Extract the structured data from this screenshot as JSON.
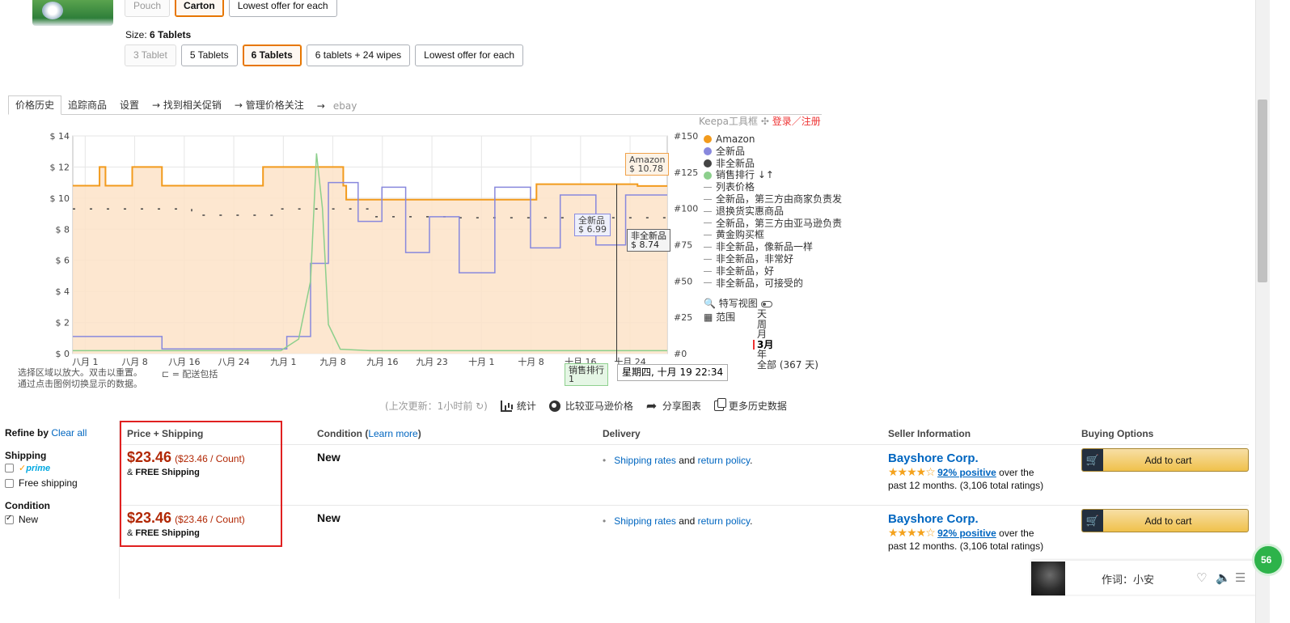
{
  "product": {
    "style_options": [
      {
        "label": "Pouch",
        "state": "disabled"
      },
      {
        "label": "Carton",
        "state": "selected"
      },
      {
        "label": "Lowest offer for each",
        "state": "normal"
      }
    ],
    "size_label": "Size:",
    "size_value": "6 Tablets",
    "size_options": [
      {
        "label": "3 Tablet",
        "state": "disabled"
      },
      {
        "label": "5 Tablets",
        "state": "normal"
      },
      {
        "label": "6 Tablets",
        "state": "selected"
      },
      {
        "label": "6 tablets + 24 wipes",
        "state": "normal"
      },
      {
        "label": "Lowest offer for each",
        "state": "normal"
      }
    ]
  },
  "keepa": {
    "tabs": [
      "价格历史",
      "追踪商品",
      "设置",
      "→ 找到相关促销",
      "→ 管理价格关注",
      "→",
      "ebay"
    ],
    "toolbox": "Keepa工具框",
    "login": "登录／注册",
    "legend": [
      {
        "label": "Amazon",
        "color": "#f29b1d",
        "kind": "dot"
      },
      {
        "label": "全新品",
        "color": "#8888dd",
        "kind": "dot"
      },
      {
        "label": "非全新品",
        "color": "#444444",
        "kind": "dot"
      },
      {
        "label": "销售排行",
        "color": "#8ccf8c",
        "kind": "dot",
        "suffix": "↓↑"
      },
      {
        "label": "列表价格",
        "kind": "dash"
      },
      {
        "label": "全新品，第三方由商家负责发",
        "kind": "dash"
      },
      {
        "label": "退换货实惠商品",
        "kind": "dash"
      },
      {
        "label": "全新品，第三方由亚马逊负责",
        "kind": "dash"
      },
      {
        "label": "黄金购买框",
        "kind": "dash"
      },
      {
        "label": "非全新品，像新品一样",
        "kind": "dash"
      },
      {
        "label": "非全新品，非常好",
        "kind": "dash"
      },
      {
        "label": "非全新品，好",
        "kind": "dash"
      },
      {
        "label": "非全新品，可接受的",
        "kind": "dash"
      }
    ],
    "closeup_label": "特写视图",
    "range_label": "范围",
    "range_options": [
      "天",
      "周",
      "月",
      "3月",
      "年",
      "全部 (367 天)"
    ],
    "range_selected": "3月",
    "tooltips": {
      "amazon_name": "Amazon",
      "amazon_price": "$ 10.78",
      "new_name": "全新品",
      "new_price": "$ 6.99",
      "used_name": "非全新品",
      "used_price": "$ 8.74",
      "rank_name": "销售排行",
      "rank_value": "1",
      "date": "星期四, 十月 19 22:34"
    },
    "note_line1": "选择区域以放大。双击以重置。",
    "note_line2": "通过点击图例切换显示的数据。",
    "note_shipping": "⊏ = 配送包括",
    "toolbar": {
      "updated": "(上次更新：1小时前 ↻)",
      "stats": "统计",
      "compare": "比较亚马逊价格",
      "share": "分享图表",
      "more": "更多历史数据"
    }
  },
  "chart_data": {
    "type": "line",
    "title": "",
    "x_categories": [
      "八月 1",
      "八月 8",
      "八月 16",
      "八月 24",
      "九月 1",
      "九月 8",
      "九月 16",
      "九月 23",
      "十月 1",
      "十月 8",
      "十月 16",
      "十月 24"
    ],
    "y_left_ticks": [
      "$ 0",
      "$ 2",
      "$ 4",
      "$ 6",
      "$ 8",
      "$ 10",
      "$ 12",
      "$ 14"
    ],
    "y_left_range": [
      0,
      14
    ],
    "y_right_ticks": [
      "#0",
      "#25",
      "#50",
      "#75",
      "#100",
      "#125",
      "#150"
    ],
    "y_right_range": [
      0,
      150
    ],
    "grid": true,
    "legend_position": "right",
    "series": [
      {
        "name": "Amazon",
        "color": "#f29b1d",
        "fill": "#fde3c8",
        "x": [
          0,
          0.045,
          0.045,
          0.055,
          0.055,
          0.1,
          0.1,
          0.15,
          0.15,
          0.32,
          0.32,
          0.455,
          0.455,
          0.46,
          0.46,
          0.78,
          0.78,
          0.95,
          0.95,
          1.0
        ],
        "values": [
          10.8,
          10.8,
          12,
          12,
          10.8,
          10.8,
          12,
          12,
          10.8,
          10.8,
          12,
          12,
          10.8,
          10.8,
          9.9,
          9.9,
          10.9,
          10.9,
          10.78,
          10.78
        ]
      },
      {
        "name": "全新品",
        "color": "#8888dd",
        "x": [
          0,
          0.15,
          0.15,
          0.36,
          0.36,
          0.4,
          0.4,
          0.43,
          0.43,
          0.48,
          0.48,
          0.52,
          0.52,
          0.56,
          0.56,
          0.6,
          0.6,
          0.65,
          0.65,
          0.71,
          0.71,
          0.77,
          0.77,
          0.82,
          0.82,
          0.88,
          0.88,
          0.93,
          0.93,
          1.0
        ],
        "values": [
          1.1,
          1.1,
          0.3,
          0.3,
          1.1,
          1.1,
          5.8,
          5.8,
          11,
          11,
          8.5,
          8.5,
          10.7,
          10.7,
          6.5,
          6.5,
          8.8,
          8.8,
          5.2,
          5.2,
          10.7,
          10.7,
          6.8,
          6.8,
          10.2,
          10.2,
          6.99,
          6.99,
          10.2,
          10.2
        ]
      },
      {
        "name": "非全新品",
        "color": "#444444",
        "x": [
          0.0,
          0.2,
          0.2,
          0.35,
          0.35,
          0.5,
          0.5,
          0.65,
          0.65,
          0.8,
          0.8,
          1.0
        ],
        "values": [
          9.3,
          9.3,
          8.9,
          8.9,
          9.3,
          9.3,
          8.8,
          8.8,
          8.74,
          8.74,
          8.74,
          8.74
        ]
      },
      {
        "name": "销售排行",
        "color": "#8ccf8c",
        "x": [
          0.0,
          0.35,
          0.38,
          0.4,
          0.41,
          0.42,
          0.43,
          0.45,
          0.5,
          1.0
        ],
        "values": [
          2,
          2,
          10,
          50,
          138,
          100,
          20,
          3,
          2,
          2
        ]
      }
    ]
  },
  "offers": {
    "refine_title": "Refine by",
    "clear_all": "Clear all",
    "shipping_heading": "Shipping",
    "prime_label": "prime",
    "free_shipping": "Free shipping",
    "condition_heading": "Condition",
    "condition_new": "New",
    "headers": {
      "price": "Price + Shipping",
      "condition": "Condition (",
      "condition_link": "Learn more",
      "condition_close": ")",
      "delivery": "Delivery",
      "seller": "Seller Information",
      "buying": "Buying Options"
    },
    "rows": [
      {
        "price": "$23.46",
        "unit": "($23.46 / Count)",
        "ship_prefix": "& ",
        "ship": "FREE Shipping",
        "condition": "New",
        "delivery_link1": "Shipping rates",
        "delivery_and": " and ",
        "delivery_link2": "return policy",
        "delivery_end": ".",
        "seller": "Bayshore Corp.",
        "stars": "★★★★☆",
        "positive": "92% positive",
        "rating_text1": " over the",
        "rating_text2": "past 12 months. (3,106 total ratings)",
        "cart": "Add to cart"
      },
      {
        "price": "$23.46",
        "unit": "($23.46 / Count)",
        "ship_prefix": "& ",
        "ship": "FREE Shipping",
        "condition": "New",
        "delivery_link1": "Shipping rates",
        "delivery_and": " and ",
        "delivery_link2": "return policy",
        "delivery_end": ".",
        "seller": "Bayshore Corp.",
        "stars": "★★★★☆",
        "positive": "92% positive",
        "rating_text1": " over the",
        "rating_text2": "past 12 months. (3,106 total ratings)",
        "cart": "Add to cart"
      }
    ]
  },
  "player": {
    "lyric": "作词：小安"
  },
  "badge": "56"
}
